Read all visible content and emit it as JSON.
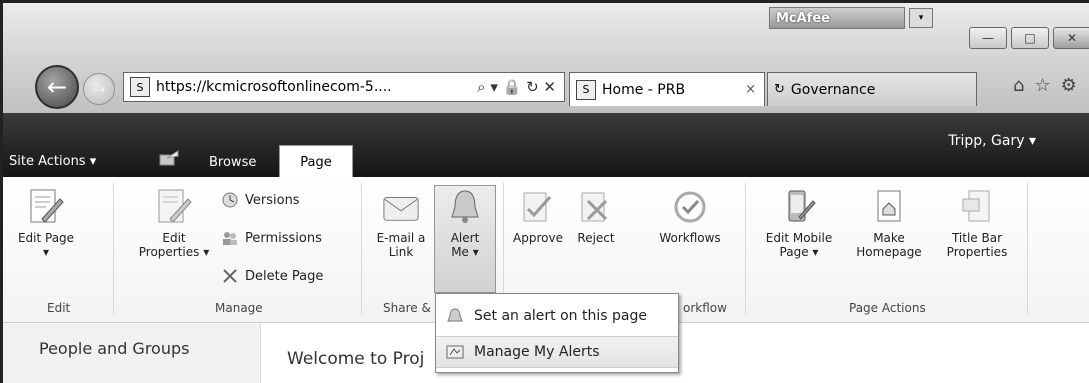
{
  "browser": {
    "addon": {
      "brand": "McAfee",
      "dropdown_glyph": "▾"
    },
    "window_controls": {
      "minimize": "—",
      "maximize": "□",
      "close": "✕"
    },
    "nav": {
      "back_glyph": "←",
      "forward_glyph": "→"
    },
    "address": {
      "url": "https://kcmicrosoftonlinecom-5....",
      "controls": "⌕ ▾ 🔒 ↻ ✕"
    },
    "tabs": [
      {
        "label": "Home - PRB",
        "close": "×",
        "active": true
      },
      {
        "label": "Governance",
        "active": false
      }
    ],
    "toolbar": {
      "home": "⌂",
      "favorites": "☆",
      "tools": "⚙"
    }
  },
  "sharepoint": {
    "user": "Tripp, Gary ▾",
    "site_actions": "Site Actions ▾",
    "tabs": {
      "browse": "Browse",
      "page": "Page"
    }
  },
  "ribbon": {
    "edit_page": {
      "line1": "Edit Page",
      "line2": "▾"
    },
    "edit_properties": {
      "line1": "Edit",
      "line2": "Properties ▾"
    },
    "versions": "Versions",
    "permissions": "Permissions",
    "delete_page": "Delete Page",
    "email_link": {
      "line1": "E-mail a",
      "line2": "Link"
    },
    "alert_me": {
      "line1": "Alert",
      "line2": "Me ▾"
    },
    "approve": "Approve",
    "reject": "Reject",
    "workflows": "Workflows",
    "edit_mobile": {
      "line1": "Edit Mobile",
      "line2": "Page ▾"
    },
    "make_homepage": {
      "line1": "Make",
      "line2": "Homepage"
    },
    "title_bar": {
      "line1": "Title Bar",
      "line2": "Properties"
    },
    "groups": {
      "edit": "Edit",
      "manage": "Manage",
      "share": "Share &",
      "workflow": "orkflow",
      "page_actions": "Page Actions"
    }
  },
  "dropdown": {
    "items": [
      {
        "label": "Set an alert on this page"
      },
      {
        "label": "Manage My Alerts"
      }
    ]
  },
  "left_nav": {
    "item": "People and Groups"
  },
  "main": {
    "welcome": "Welcome to Proj"
  }
}
